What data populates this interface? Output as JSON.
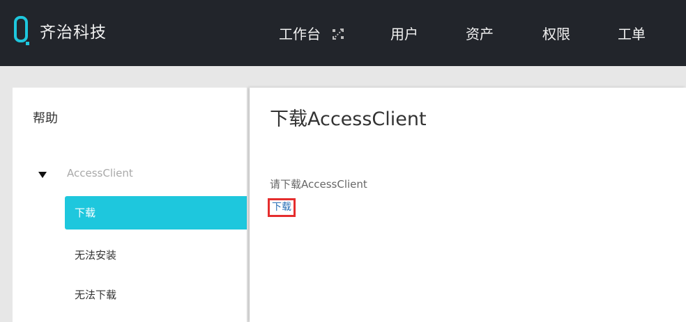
{
  "header": {
    "brand": "齐治科技",
    "logo_icon": "logo-q-icon",
    "accent_color": "#1ec7dd",
    "nav": {
      "workbench": "工作台",
      "workbench_icon": "expand-arrows-icon",
      "users": "用户",
      "assets": "资产",
      "permissions": "权限",
      "tickets": "工单"
    }
  },
  "sidebar": {
    "title": "帮助",
    "caret_icon": "caret-down-icon",
    "group": "AccessClient",
    "items": [
      {
        "label": "下载",
        "active": true
      },
      {
        "label": "无法安装",
        "active": false
      },
      {
        "label": "无法下载",
        "active": false
      }
    ]
  },
  "main": {
    "title": "下载AccessClient",
    "description": "请下载AccessClient",
    "download_link": "下载",
    "link_color": "#2a6fb6",
    "highlight_color": "#e52d2d"
  }
}
